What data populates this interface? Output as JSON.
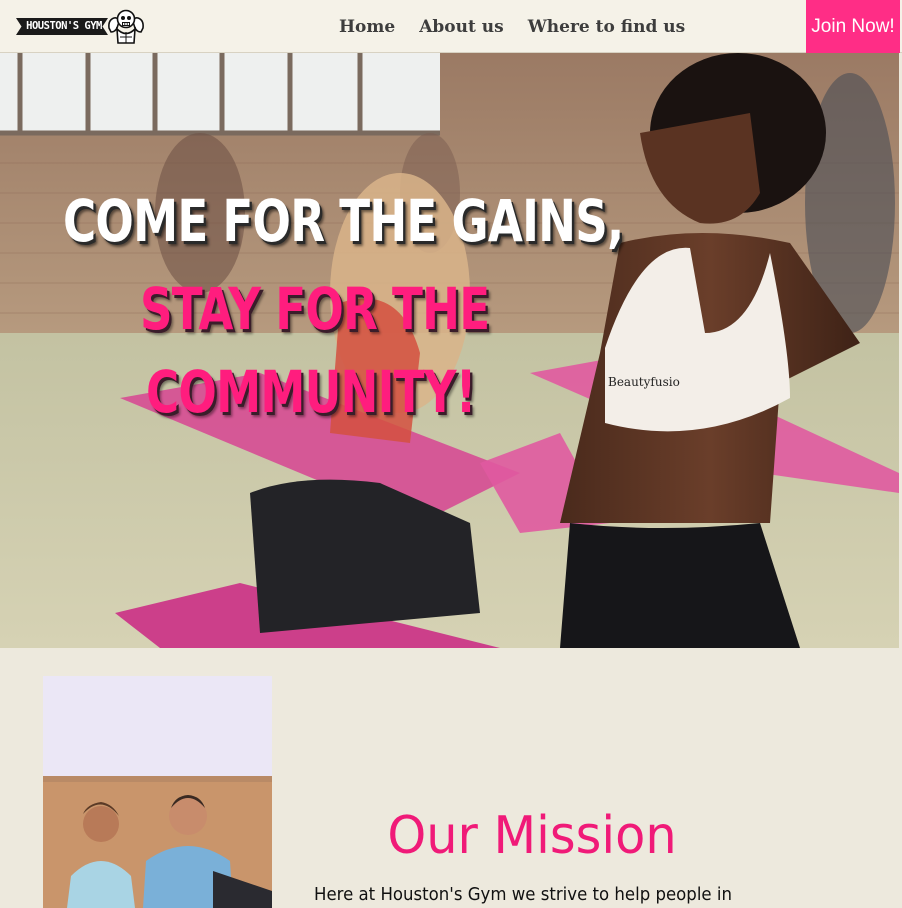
{
  "navbar": {
    "logo_text": "HOUSTON'S GYM",
    "links": [
      {
        "label": "Home"
      },
      {
        "label": "About us"
      },
      {
        "label": "Where to find us"
      }
    ],
    "join_label": "Join Now!"
  },
  "hero": {
    "line1": "COME FOR THE GAINS,",
    "line2": "STAY FOR THE",
    "line3": "COMMUNITY!",
    "bra_text": "Beautyfusio"
  },
  "mission": {
    "title": "Our Mission",
    "text": "Here at Houston's Gym we strive to help people in"
  },
  "colors": {
    "accent": "#ff2d86",
    "background": "#ede9dd",
    "navbar": "#f5f2e8"
  },
  "icons": {
    "logo_mascot": "muscle-skull-icon"
  }
}
